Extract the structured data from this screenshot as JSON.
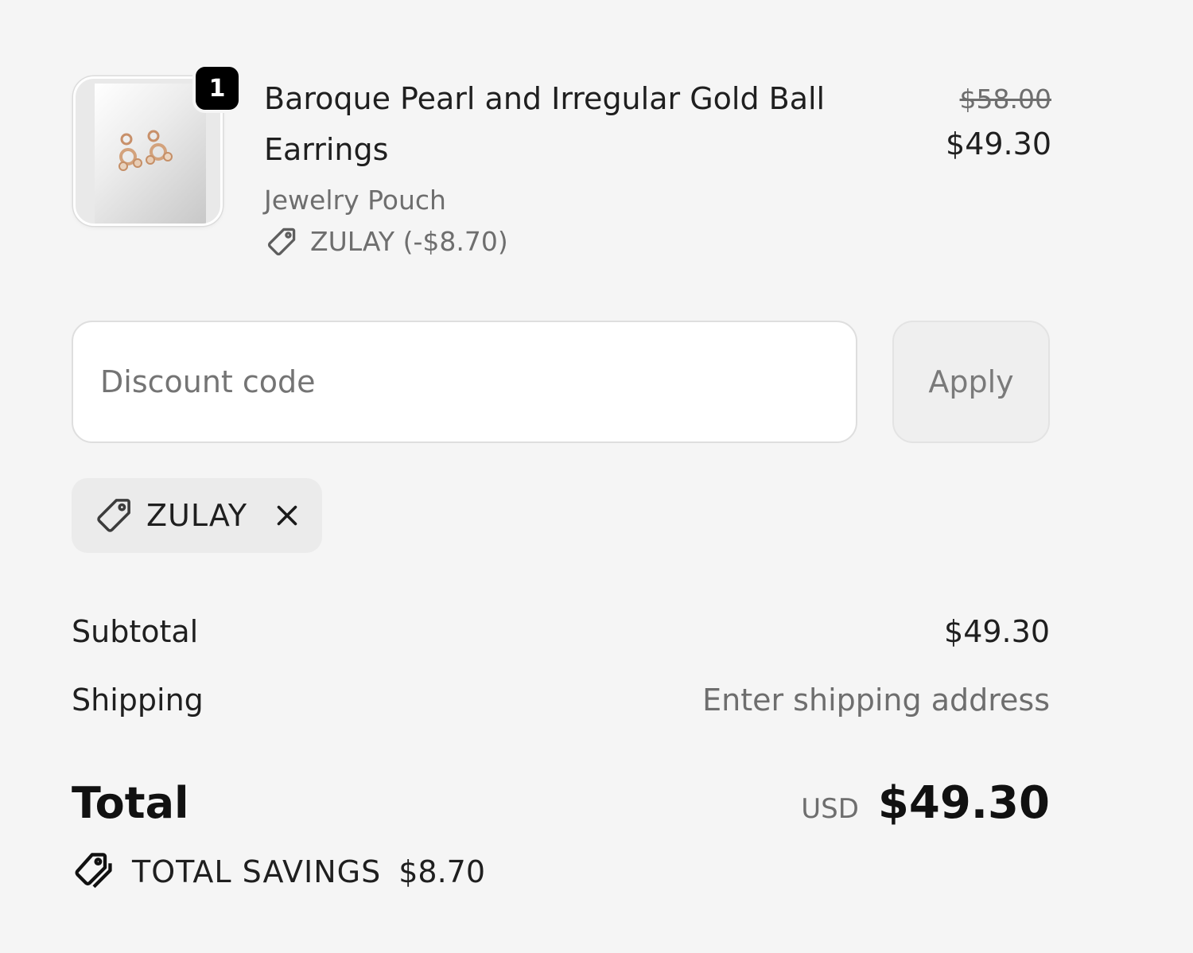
{
  "line_item": {
    "quantity": "1",
    "title": "Baroque Pearl and Irregular Gold Ball Earrings",
    "variant": "Jewelry Pouch",
    "discount_text": "ZULAY (-$8.70)",
    "compare_price": "$58.00",
    "price": "$49.30",
    "image_icon": "product-photo"
  },
  "discount_form": {
    "placeholder": "Discount code",
    "apply_label": "Apply"
  },
  "applied_code": {
    "label": "ZULAY",
    "icon": "tag-icon",
    "remove_icon": "close-icon"
  },
  "summary": {
    "subtotal_label": "Subtotal",
    "subtotal_value": "$49.30",
    "shipping_label": "Shipping",
    "shipping_value": "Enter shipping address",
    "total_label": "Total",
    "currency": "USD",
    "total_value": "$49.30",
    "savings_label": "TOTAL SAVINGS",
    "savings_value": "$8.70"
  },
  "colors": {
    "background": "#f5f5f5",
    "badge": "#000000",
    "muted_text": "#6e6e6e",
    "primary_text": "#1f1f1f"
  }
}
